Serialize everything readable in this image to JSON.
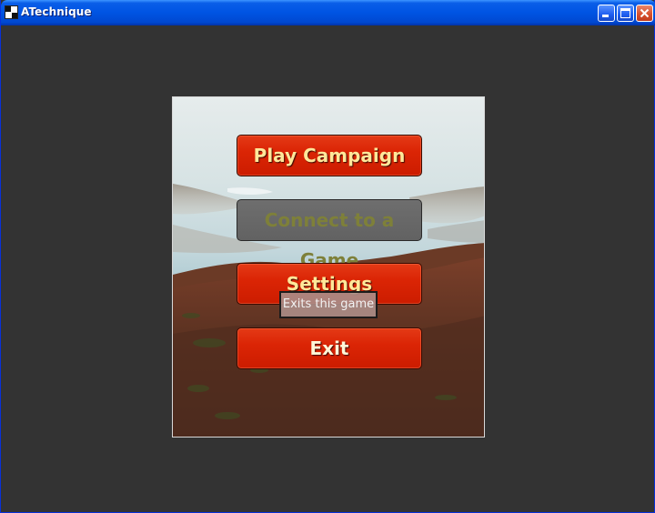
{
  "window": {
    "title": "ATechnique",
    "controls": {
      "minimize_icon": "minimize-icon",
      "maximize_icon": "maximize-icon",
      "close_icon": "close-icon"
    }
  },
  "menu": {
    "buttons": [
      {
        "label": "Play Campaign",
        "enabled": true
      },
      {
        "label": "Connect to a Game",
        "enabled": false
      },
      {
        "label": "Settings",
        "enabled": true
      },
      {
        "label": "Exit",
        "enabled": true
      }
    ],
    "tooltip": "Exits this game"
  },
  "colors": {
    "titlebar": "#0054e3",
    "button_red": "#db2505",
    "button_text": "#ffe89a",
    "disabled_button": "#666666",
    "disabled_text": "#7e8039",
    "window_bg": "#333333"
  }
}
